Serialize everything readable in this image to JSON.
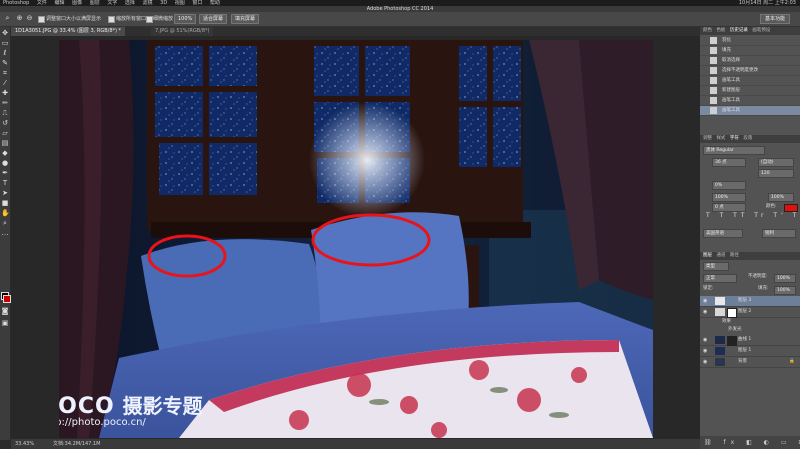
{
  "menubar": {
    "app": "Photoshop",
    "items": [
      "文件",
      "编辑",
      "图像",
      "图层",
      "文字",
      "选择",
      "滤镜",
      "3D",
      "视图",
      "窗口",
      "帮助"
    ],
    "clock": "10月14日 周二 上午2:03"
  },
  "window_title": "Adobe Photoshop CC 2014",
  "options_bar": {
    "resize_windows": "调整窗口大小以满屏显示",
    "zoom_all_windows": "缩放所有窗口",
    "scrubby_zoom": "细微缩放",
    "zoom_100": "100%",
    "fit_screen": "适合屏幕",
    "fill_screen": "填充屏幕",
    "workspace": "基本功能"
  },
  "tabs": [
    {
      "label": "1D1A3051.JPG @ 33.4% (图层 3, RGB/8*) *",
      "active": true
    },
    {
      "label": "7.JPG @ 51%(RGB/8*)",
      "active": false
    }
  ],
  "status": {
    "zoom": "33.43%",
    "doc": "文档:34.2M/147.1M"
  },
  "watermark": {
    "brand": "POCO",
    "title": "摄影专题",
    "url": "http://photo.poco.cn/"
  },
  "history_panel": {
    "tabs": [
      "颜色",
      "色板",
      "历史记录",
      "画笔预设"
    ],
    "items": [
      "羽化",
      "填充",
      "取消选择",
      "选择不透明度更改",
      "画笔工具",
      "新建图层",
      "画笔工具",
      "画笔工具"
    ]
  },
  "character_panel": {
    "tabs": [
      "调整",
      "样式",
      "字符",
      "段落"
    ],
    "font_family": "黑体 Regular",
    "font_size": "36 点",
    "leading": "(自动)",
    "tracking": "120",
    "kerning": "0%",
    "vscale": "100%",
    "hscale": "100%",
    "baseline": "0 点",
    "color_label": "颜色:",
    "language": "美国英语",
    "aa": "锐利"
  },
  "layers_panel": {
    "tabs": [
      "图层",
      "通道",
      "路径"
    ],
    "filter": "类型",
    "blend_mode": "正常",
    "opacity_label": "不透明度:",
    "opacity": "100%",
    "lock_label": "锁定:",
    "fill_label": "填充:",
    "fill": "100%",
    "layers": [
      {
        "name": "图层 3",
        "selected": true
      },
      {
        "name": "图层 2",
        "selected": false
      },
      {
        "name": "效果",
        "selected": false
      },
      {
        "name": "外发光",
        "selected": false
      },
      {
        "name": "曲线 1",
        "selected": false
      },
      {
        "name": "图层 1",
        "selected": false
      },
      {
        "name": "背景",
        "selected": false
      }
    ]
  }
}
